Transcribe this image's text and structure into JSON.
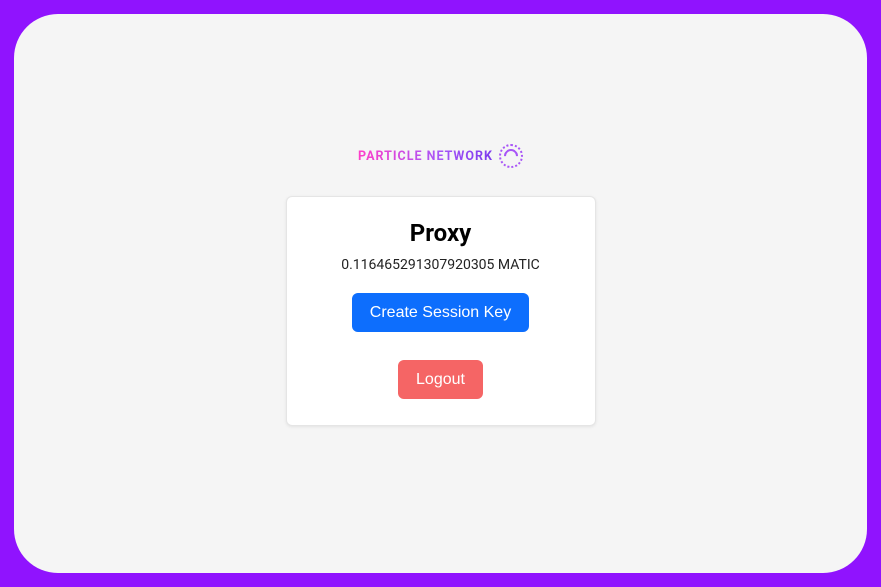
{
  "logo": {
    "text": "PARTICLE NETWORK"
  },
  "card": {
    "title": "Proxy",
    "balance_display": "0.116465291307920305 MATIC",
    "create_session_label": "Create Session Key",
    "logout_label": "Logout"
  }
}
